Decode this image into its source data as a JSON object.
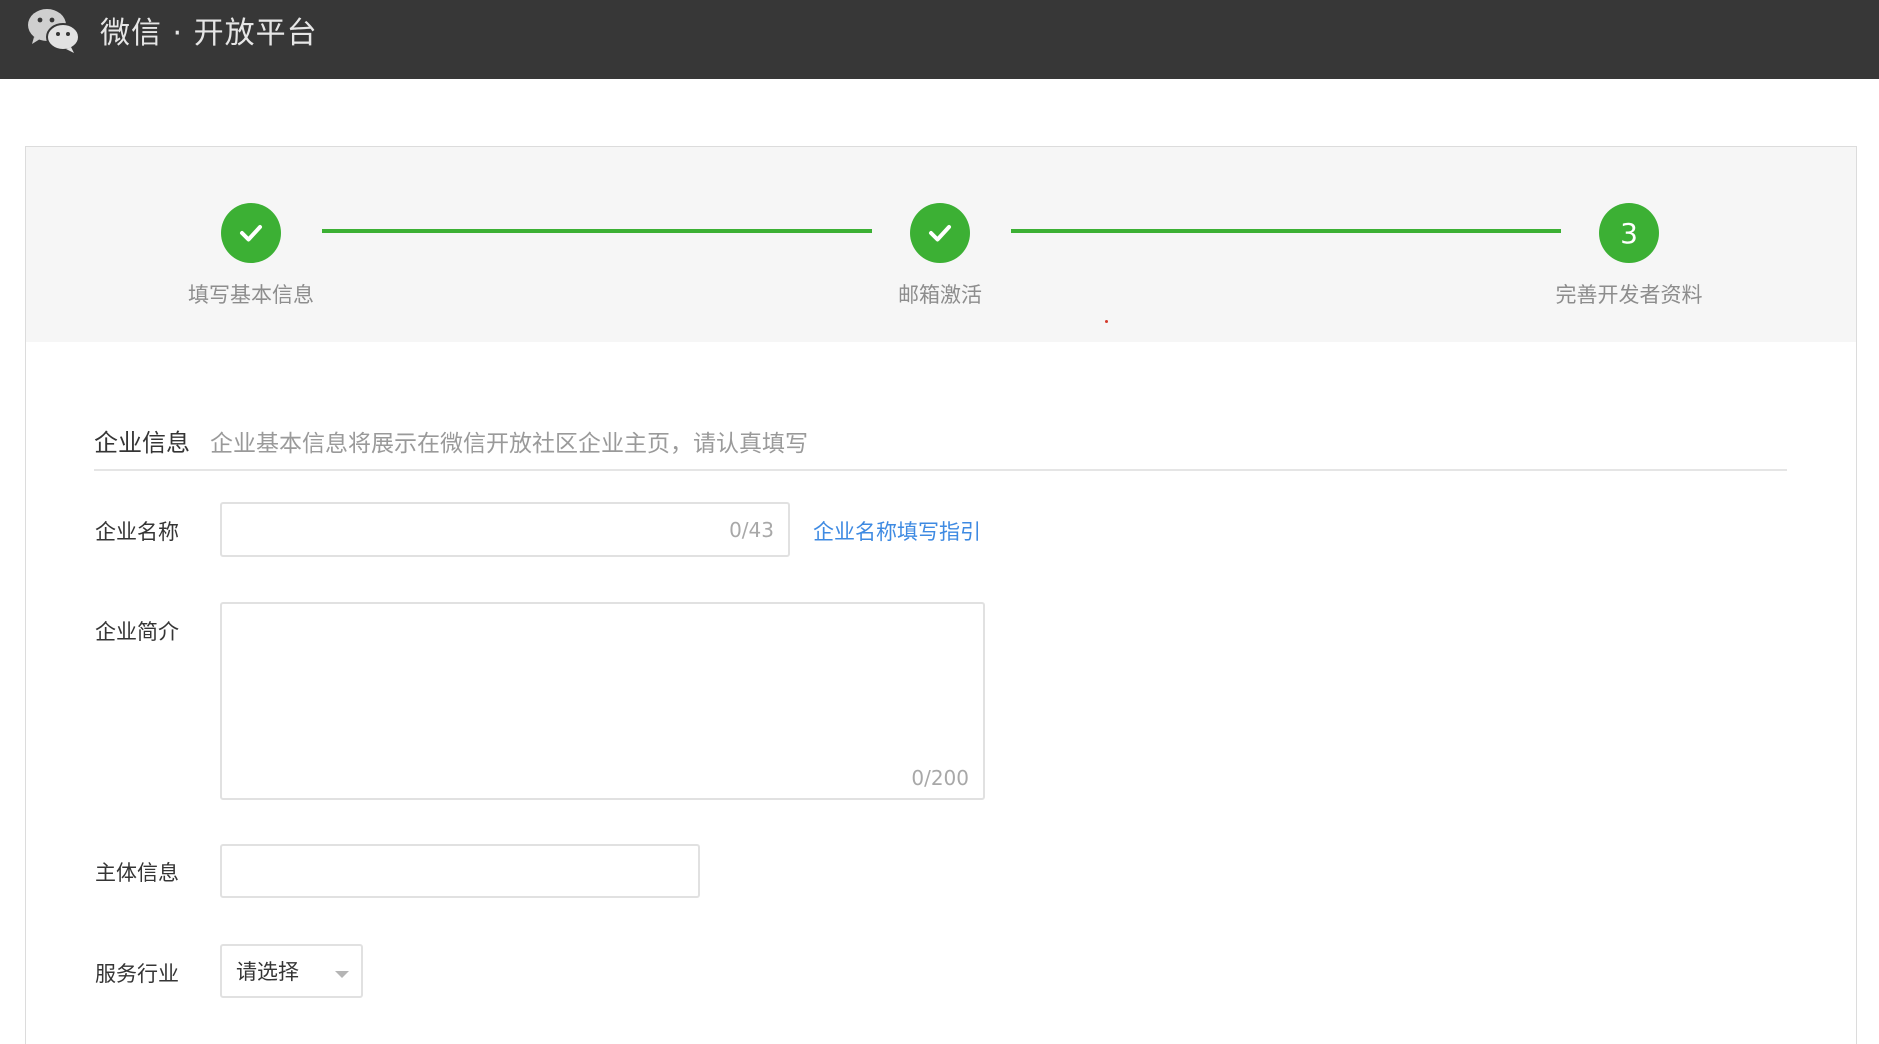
{
  "header": {
    "brand": "微信 · 开放平台",
    "logo_icon": "wechat-logo-icon"
  },
  "steps": [
    {
      "label": "填写基本信息",
      "state": "done",
      "icon": "check-icon"
    },
    {
      "label": "邮箱激活",
      "state": "done",
      "icon": "check-icon"
    },
    {
      "label": "完善开发者资料",
      "state": "current",
      "number": "3"
    }
  ],
  "colors": {
    "accent": "#3cb034",
    "link": "#3e8ae2",
    "topbar": "#373737"
  },
  "section": {
    "title": "企业信息",
    "tip": "企业基本信息将展示在微信开放社区企业主页，请认真填写"
  },
  "form": {
    "company_name": {
      "label": "企业名称",
      "value": "",
      "counter": "0/43",
      "guide_link": "企业名称填写指引"
    },
    "company_intro": {
      "label": "企业简介",
      "value": "",
      "counter": "0/200"
    },
    "entity_info": {
      "label": "主体信息",
      "value": ""
    },
    "industry": {
      "label": "服务行业",
      "selected": "请选择",
      "icon": "chevron-down-icon"
    }
  }
}
